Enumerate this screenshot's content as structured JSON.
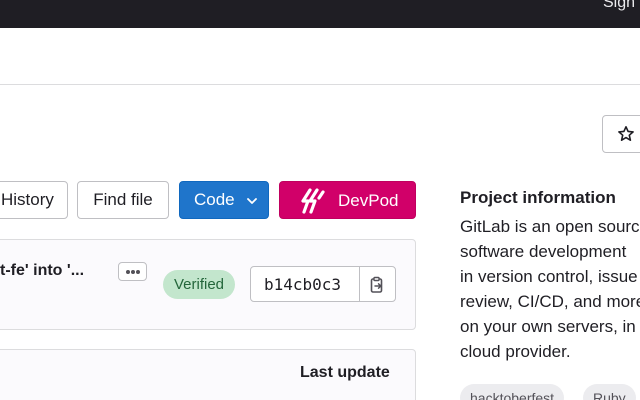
{
  "topbar": {
    "sign_in": "Sign in"
  },
  "repo_actions": {
    "history_label": "History",
    "find_file_label": "Find file",
    "code_label": "Code",
    "devpod_label": "DevPod"
  },
  "last_commit": {
    "message": "t-fe' into '...",
    "verified_label": "Verified",
    "sha": "b14cb0c3"
  },
  "file_table": {
    "last_update_header": "Last update"
  },
  "project_info": {
    "title": "Project information",
    "description_lines": [
      "GitLab is an open source",
      "software development",
      "in version control, issue",
      "review, CI/CD, and more",
      "on your own servers, in",
      "cloud provider."
    ],
    "topics": [
      "hacktoberfest",
      "Ruby"
    ]
  },
  "colors": {
    "topbar_bg": "#1f1e24",
    "code_button": "#1f75cb",
    "devpod_button": "#d10069",
    "verified_badge_bg": "#c3e6cd",
    "verified_badge_text": "#24663b"
  }
}
